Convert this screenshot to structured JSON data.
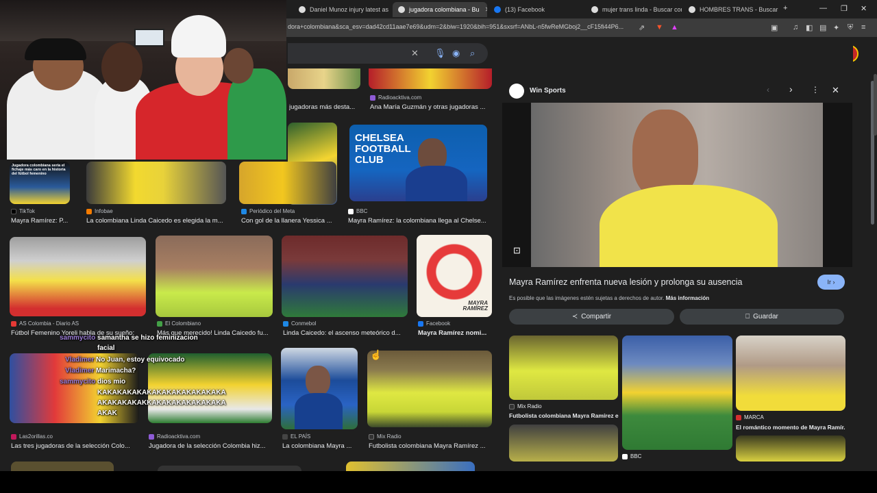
{
  "tabs": [
    {
      "label": "Daniel Munoz injury latest as C",
      "x": 0
    },
    {
      "label": "jugadora colombiana - Bu",
      "x": 0,
      "active": true
    },
    {
      "label": "(13) Facebook",
      "x": 0
    },
    {
      "label": "mujer trans linda - Buscar con",
      "x": 0
    },
    {
      "label": "HOMBRES TRANS - Buscar con",
      "x": 0
    }
  ],
  "address": {
    "url": "dora+colombiana&sca_esv=dad42cd11aae7e69&udm=2&biw=1920&bih=951&sxsrf=ANbL-n5fwReMGboj2__cF15fi44P6..."
  },
  "results": {
    "row0": [
      {
        "caption": "jugadoras más desta...",
        "source": ""
      },
      {
        "caption": "Ana María Guzmán y otras jugadoras ...",
        "source": "Radioacktiva.com"
      }
    ],
    "row1": [
      {
        "source": "TikTok",
        "caption": "Mayra Ramírez: P...",
        "overlay": "Jugadora colombiana sería el fichaje más caro en la historia del fútbol femenino"
      },
      {
        "source": "Infobae",
        "caption": "La colombiana Linda Caicedo es elegida la m..."
      },
      {
        "source": "Periódico del Meta",
        "caption": "Con gol de la llanera Yessica ..."
      },
      {
        "source": "BBC",
        "caption": "Mayra Ramírez: la colombiana llega al Chelse..."
      }
    ],
    "row2": [
      {
        "source": "AS Colombia - Diario AS",
        "caption": "Fútbol Femenino Yoreli habla de su sueño:"
      },
      {
        "source": "El Colombiano",
        "caption": "Más que merecido! Linda Caicedo fu..."
      },
      {
        "source": "Conmebol",
        "caption": "Linda Caicedo: el ascenso meteórico d..."
      },
      {
        "source": "Facebook",
        "caption": "Mayra Ramírez nomi..."
      }
    ],
    "row3": [
      {
        "source": "Las2orillas.co",
        "caption": "Las tres jugadoras de la selección Colo..."
      },
      {
        "source": "Radioacktiva.com",
        "caption": "Jugadora de la selección Colombia hiz..."
      },
      {
        "source": "EL PAÍS",
        "caption": "La colombiana Mayra ..."
      },
      {
        "source": "Mix Radio",
        "caption": "Futbolista colombiana Mayra Ramírez ..."
      }
    ],
    "chelsea_text": "CHELSEA FOOTBALL CLUB",
    "mayra_overlay": "MAYRA RAMÍREZ"
  },
  "chat": [
    {
      "user": "sammycito",
      "msg": "samantha se hizo feminizacion"
    },
    {
      "user": "",
      "msg": "facial"
    },
    {
      "user": "Vladimer",
      "msg": "No Juan, estoy equivocado"
    },
    {
      "user": "Vladimer",
      "msg": "Marimacha?"
    },
    {
      "user": "sammycito",
      "msg": "dios mio"
    },
    {
      "user": "",
      "msg": "KAKAKAKAKAKAKAKAKAKAKAKAKA"
    },
    {
      "user": "",
      "msg": "AKAKAKAKAKKAKAKAKAKAKAKAKA"
    },
    {
      "user": "",
      "msg": "AKAK"
    }
  ],
  "panel": {
    "site": "Win Sports",
    "title": "Mayra Ramírez enfrenta nueva lesión y prolonga su ausencia",
    "go_label": "Ir",
    "notice": "Es posible que las imágenes estén sujetas a derechos de autor.",
    "more_info": "Más información",
    "share_label": "Compartir",
    "save_label": "Guardar",
    "related": [
      {
        "source": "Mix Radio",
        "caption": "Futbolista colombiana Mayra Ramírez e..."
      },
      {
        "source": "BBC",
        "caption": ""
      },
      {
        "source": "MARCA",
        "caption": "El romántico momento de Mayra Ramír..."
      }
    ]
  }
}
